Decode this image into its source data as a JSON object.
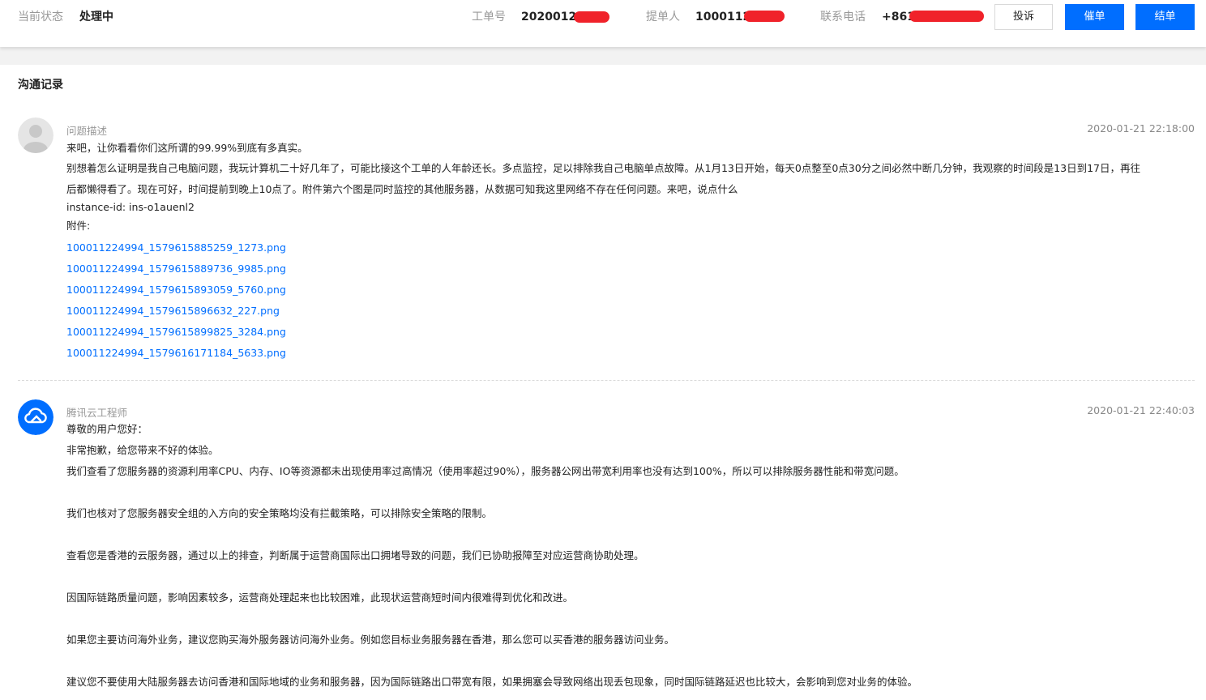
{
  "header": {
    "status_label": "当前状态",
    "status_value": "处理中",
    "ticket_label": "工单号",
    "ticket_value": "20200121",
    "submitter_label": "提单人",
    "submitter_value": "1000112",
    "phone_label": "联系电话",
    "phone_value": "+861",
    "complain_button": "投诉",
    "urge_button": "催单",
    "close_button": "结单",
    "primary_color": "#006eff",
    "redaction_color": "#f0222a"
  },
  "section": {
    "title": "沟通记录"
  },
  "messages": [
    {
      "name": "问题描述",
      "time": "2020-01-21 22:18:00",
      "lines": [
        "来吧，让你看看你们这所谓的99.99%到底有多真实。",
        "别想着怎么证明是我自己电脑问题，我玩计算机二十好几年了，可能比接这个工单的人年龄还长。多点监控，足以排除我自己电脑单点故障。从1月13日开始，每天0点整至0点30分之间必然中断几分钟，我观察的时间段是13日到17日，再往",
        "后都懒得看了。现在可好，时间提前到晚上10点了。附件第六个图是同时监控的其他服务器，从数据可知我这里网络不存在任何问题。来吧，说点什么",
        "instance-id: ins-o1auenl2",
        "附件:"
      ],
      "attachments": [
        "100011224994_1579615885259_1273.png",
        "100011224994_1579615889736_9985.png",
        "100011224994_1579615893059_5760.png",
        "100011224994_1579615896632_227.png",
        "100011224994_1579615899825_3284.png",
        "100011224994_1579616171184_5633.png"
      ]
    },
    {
      "name": "腾讯云工程师",
      "time": "2020-01-21 22:40:03",
      "lines": [
        "尊敬的用户您好：",
        "非常抱歉，给您带来不好的体验。",
        "我们查看了您服务器的资源利用率CPU、内存、IO等资源都未出现使用率过高情况（使用率超过90%），服务器公网出带宽利用率也没有达到100%，所以可以排除服务器性能和带宽问题。",
        "我们也核对了您服务器安全组的入方向的安全策略均没有拦截策略，可以排除安全策略的限制。",
        "查看您是香港的云服务器，通过以上的排查，判断属于运营商国际出口拥堵导致的问题，我们已协助报障至对应运营商协助处理。",
        "因国际链路质量问题，影响因素较多，运营商处理起来也比较困难，此现状运营商短时间内很难得到优化和改进。",
        "如果您主要访问海外业务，建议您购买海外服务器访问海外业务。例如您目标业务服务器在香港，那么您可以买香港的服务器访问业务。",
        "建议您不要使用大陆服务器去访问香港和国际地域的业务和服务器，因为国际链路出口带宽有限，如果拥塞会导致网络出现丢包现象，同时国际链路延迟也比较大，会影响到您对业务的体验。"
      ]
    }
  ]
}
